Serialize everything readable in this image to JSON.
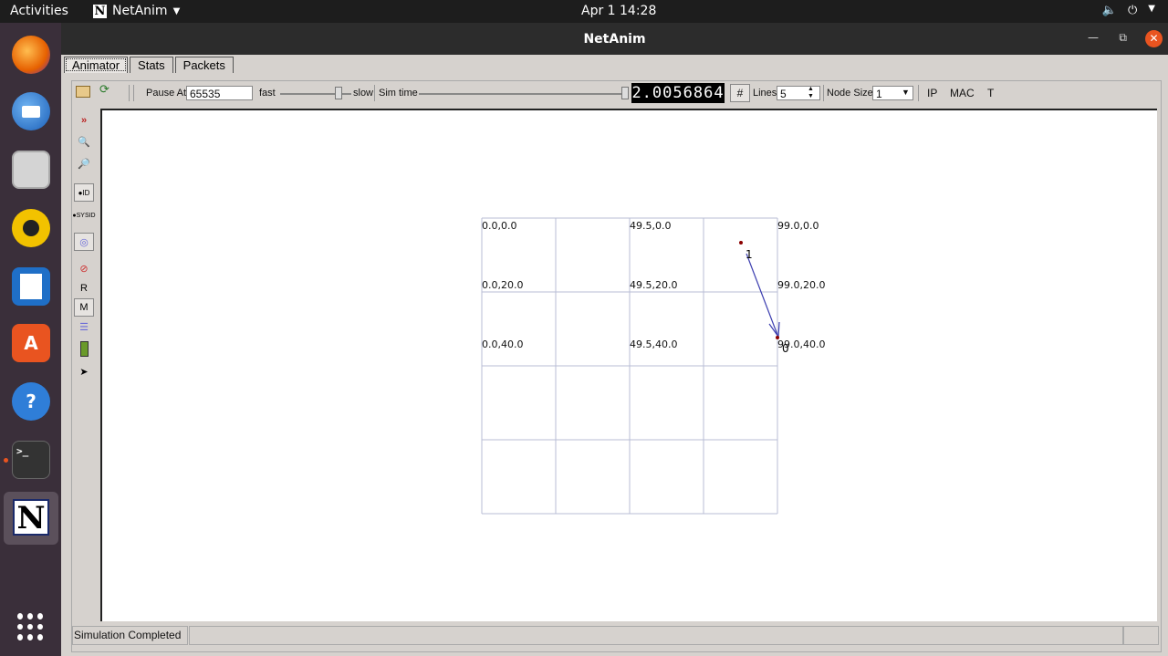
{
  "topbar": {
    "activities": "Activities",
    "app_name": "NetAnim",
    "clock": "Apr 1  14:28"
  },
  "window": {
    "title": "NetAnim"
  },
  "tabs": [
    {
      "label": "Animator",
      "active": true
    },
    {
      "label": "Stats",
      "active": false
    },
    {
      "label": "Packets",
      "active": false
    }
  ],
  "toolbar": {
    "pause_at_label": "Pause At",
    "pause_at_value": "65535",
    "fast_label": "fast",
    "slow_label": "slow",
    "sim_time_label": "Sim time",
    "sim_time_value": "2.0056864",
    "lines_label": "Lines",
    "lines_value": "5",
    "node_size_label": "Node Size",
    "node_size_value": "1",
    "ip_label": "IP",
    "mac_label": "MAC",
    "t_label": "T",
    "speed_position": 0.95,
    "sim_time_position": 1.0
  },
  "left_tools": {
    "r_label": "R",
    "m_label": "M"
  },
  "grid": {
    "labels": [
      "0.0,0.0",
      "49.5,0.0",
      "99.0,0.0",
      "0.0,20.0",
      "49.5,20.0",
      "99.0,20.0",
      "0.0,40.0",
      "49.5,40.0",
      "99.0,40.0"
    ],
    "line_color": "#b8bed6"
  },
  "nodes": [
    {
      "id": "0"
    },
    {
      "id": "1"
    }
  ],
  "status": {
    "message": "Simulation Completed"
  },
  "colors": {
    "packet_line": "#3d3fb0",
    "node": "#8b0000",
    "dock_accent": "#e95420"
  }
}
